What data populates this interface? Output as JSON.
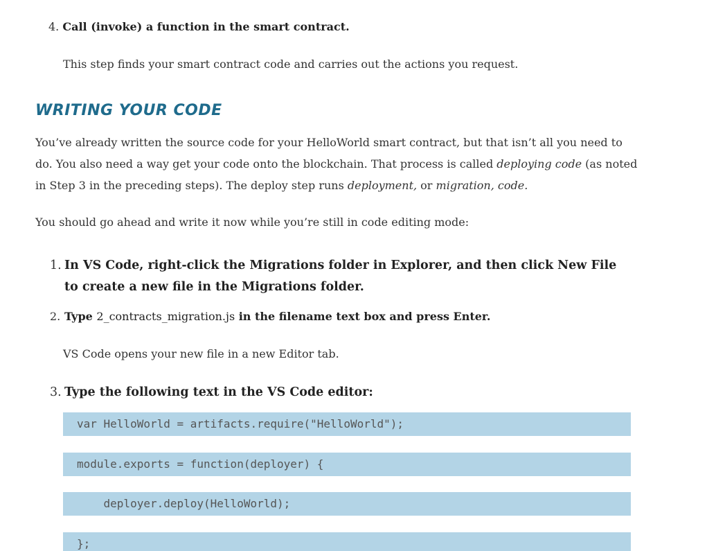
{
  "step4": {
    "number": "4.",
    "title": "Call (invoke) a function in the smart contract.",
    "description": "This step finds your smart contract code and carries out the actions you request."
  },
  "section": {
    "heading": "WRITING YOUR CODE"
  },
  "paragraph1": {
    "part1": "You’ve already written the source code for your HelloWorld smart contract, but that isn’t all you need to do. You also need a way get your code onto the blockchain. That process is called ",
    "em1": "deploying code",
    "part2": " (as noted in Step 3 in the preceding steps). The deploy step runs ",
    "em2": "deployment,",
    "part3": " or ",
    "em3": "migration, code."
  },
  "paragraph2": "You should go ahead and write it now while you’re still in code editing mode:",
  "steps": [
    {
      "number": "1.",
      "text": "In VS Code, right-click the Migrations folder in Explorer, and then click New File to create a new file in the Migrations folder."
    },
    {
      "number": "2.",
      "text_before": "Type ",
      "filename": "2_contracts_migration.js",
      "text_after": " in the filename text box and press Enter.",
      "description": "VS Code opens your new file in a new Editor tab."
    },
    {
      "number": "3.",
      "text": "Type the following text in the VS Code editor:"
    }
  ],
  "code_lines": [
    "var HelloWorld = artifacts.require(\"HelloWorld\");",
    "module.exports = function(deployer) {",
    "    deployer.deploy(HelloWorld);",
    "};"
  ]
}
